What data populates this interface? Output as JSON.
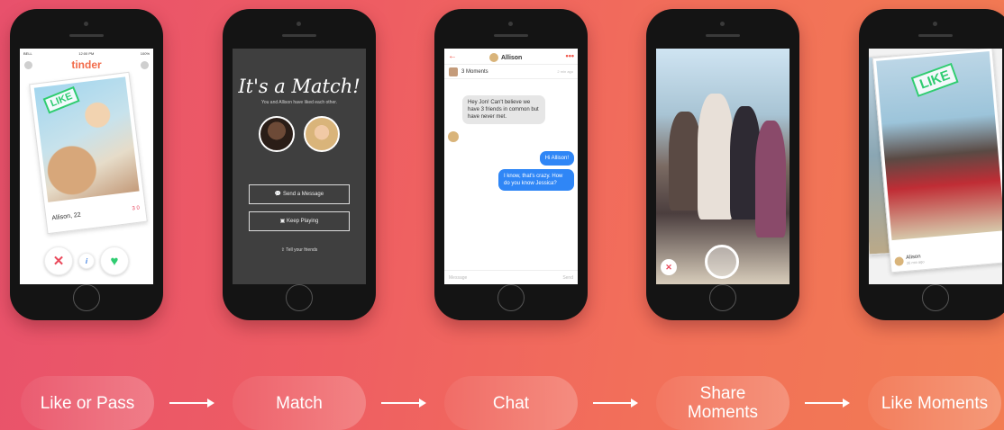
{
  "phones": {
    "like": {
      "status": {
        "carrier": "BELL",
        "time": "12:00 PM",
        "battery": "100%"
      },
      "app_logo": "tinder",
      "stamp": "LIKE",
      "card_name": "Allison, 22",
      "card_stats": "3   0",
      "info_label": "i"
    },
    "match": {
      "title": "It's a Match!",
      "subtitle": "You and Allison have liked each other.",
      "send_message": "Send a Message",
      "keep_playing": "Keep Playing",
      "tell_friends": "Tell your friends"
    },
    "chat": {
      "contact": "Allison",
      "moments": "3 Moments",
      "moments_time": "2 min ago",
      "msg_in": "Hey Jon! Can't believe we have 3 friends in common but have never met.",
      "msg_out1": "Hi Allison!",
      "msg_out2": "I know, that's crazy. How do you know Jessica?",
      "input_placeholder": "Message",
      "send_label": "Send"
    },
    "like_moments": {
      "stamp": "LIKE",
      "name": "Alison",
      "time": "26 min ago"
    }
  },
  "steps": [
    {
      "label": "Like or Pass"
    },
    {
      "label": "Match"
    },
    {
      "label": "Chat"
    },
    {
      "label": "Share Moments"
    },
    {
      "label": "Like Moments"
    }
  ]
}
